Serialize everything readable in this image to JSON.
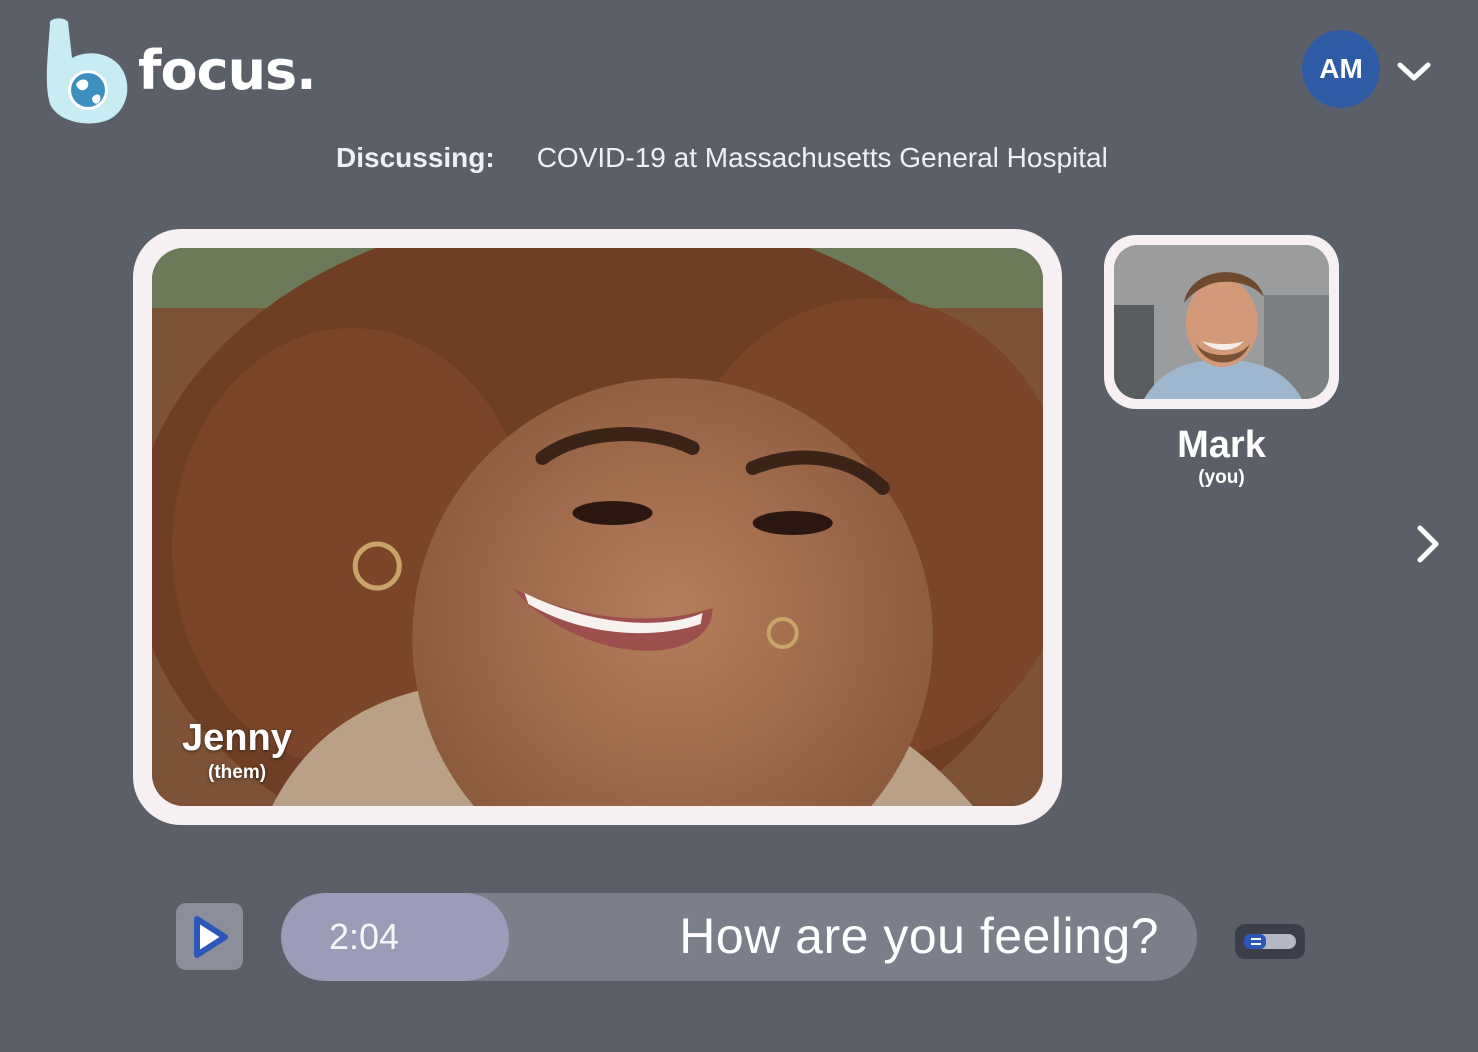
{
  "app": {
    "name": "focus."
  },
  "account": {
    "initials": "AM"
  },
  "topic": {
    "label": "Discussing:",
    "value": "COVID-19 at Massachusetts General Hospital"
  },
  "main_video": {
    "name": "Jenny",
    "tag": "(them)"
  },
  "self_video": {
    "name": "Mark",
    "tag": "(you)"
  },
  "prompt": {
    "timer": "2:04",
    "text": "How are you feeling?"
  },
  "icons": {
    "logo": "focus-logo-icon",
    "account_menu": "chevron-down-icon",
    "next": "chevron-right-icon",
    "play": "play-icon",
    "toggle": "caption-toggle-icon"
  },
  "colors": {
    "background": "#5b5f68",
    "accent": "#2f5ba6",
    "frame": "#f7f0f2",
    "timer_pill": "#9a9cb8",
    "prompt_bar": "#7b7f89"
  }
}
